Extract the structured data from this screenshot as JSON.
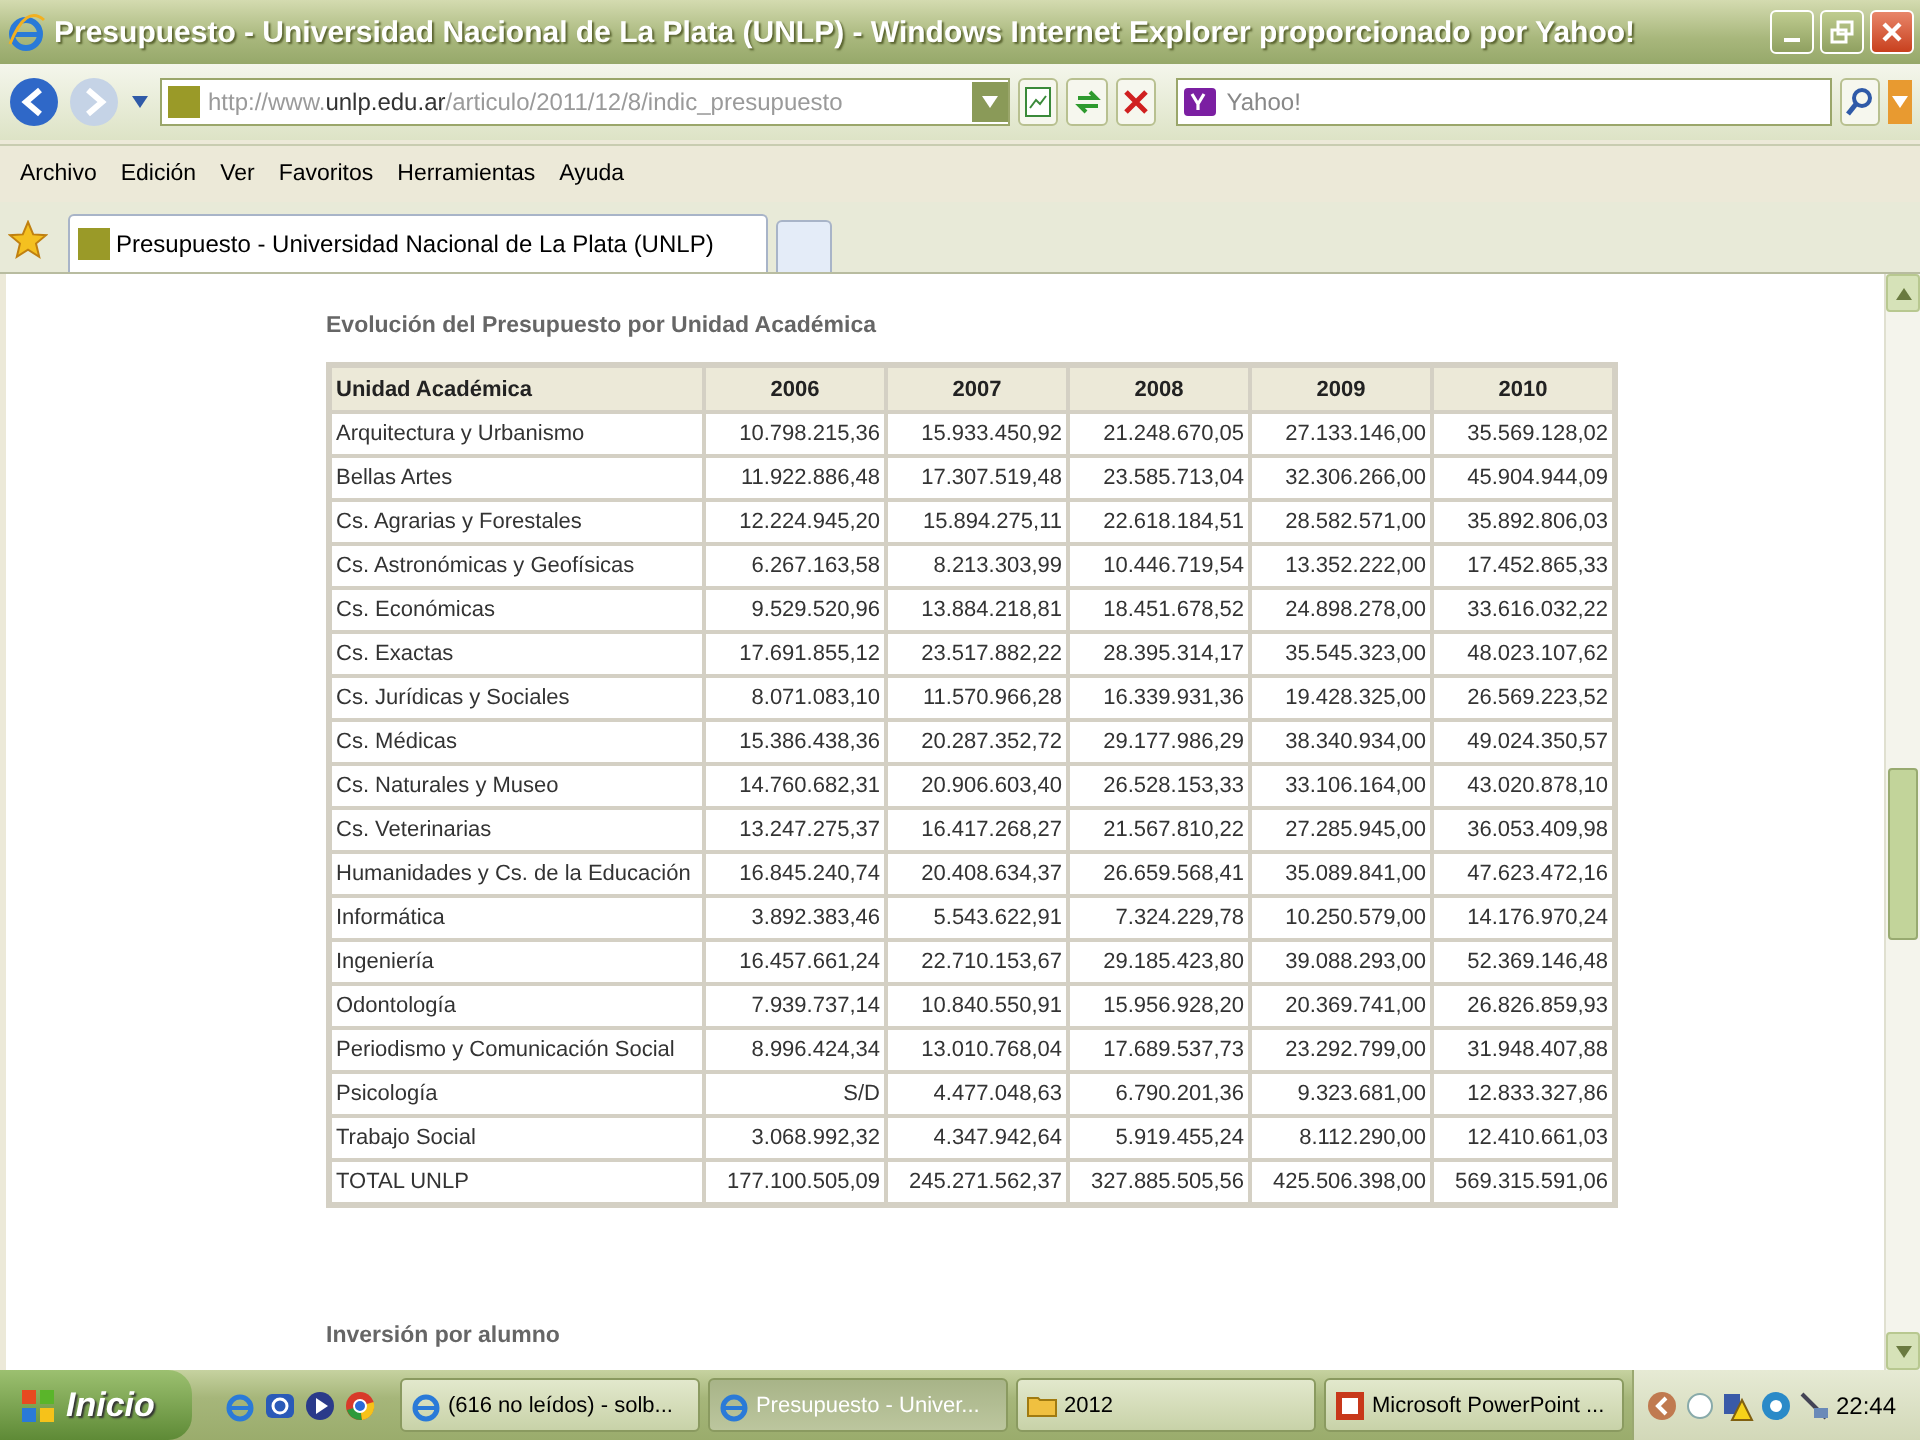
{
  "window": {
    "title": "Presupuesto - Universidad Nacional de La Plata (UNLP) - Windows Internet Explorer proporcionado por Yahoo!"
  },
  "address_bar": {
    "url_prefix": "http://www.",
    "url_domain": "unlp.edu.ar",
    "url_path": "/articulo/2011/12/8/indic_presupuesto"
  },
  "search": {
    "placeholder": "Yahoo!"
  },
  "menu": [
    "Archivo",
    "Edición",
    "Ver",
    "Favoritos",
    "Herramientas",
    "Ayuda"
  ],
  "tabs": [
    {
      "label": "Presupuesto - Universidad Nacional de La Plata (UNLP)",
      "selected": true
    }
  ],
  "page": {
    "heading": "Evolución del Presupuesto por Unidad Académica",
    "table": {
      "columns": [
        "Unidad Académica",
        "2006",
        "2007",
        "2008",
        "2009",
        "2010"
      ],
      "rows": [
        [
          "Arquitectura y Urbanismo",
          "10.798.215,36",
          "15.933.450,92",
          "21.248.670,05",
          "27.133.146,00",
          "35.569.128,02"
        ],
        [
          "Bellas Artes",
          "11.922.886,48",
          "17.307.519,48",
          "23.585.713,04",
          "32.306.266,00",
          "45.904.944,09"
        ],
        [
          "Cs. Agrarias y Forestales",
          "12.224.945,20",
          "15.894.275,11",
          "22.618.184,51",
          "28.582.571,00",
          "35.892.806,03"
        ],
        [
          "Cs. Astronómicas y Geofísicas",
          "6.267.163,58",
          "8.213.303,99",
          "10.446.719,54",
          "13.352.222,00",
          "17.452.865,33"
        ],
        [
          "Cs. Económicas",
          "9.529.520,96",
          "13.884.218,81",
          "18.451.678,52",
          "24.898.278,00",
          "33.616.032,22"
        ],
        [
          "Cs. Exactas",
          "17.691.855,12",
          "23.517.882,22",
          "28.395.314,17",
          "35.545.323,00",
          "48.023.107,62"
        ],
        [
          "Cs. Jurídicas y Sociales",
          "8.071.083,10",
          "11.570.966,28",
          "16.339.931,36",
          "19.428.325,00",
          "26.569.223,52"
        ],
        [
          "Cs. Médicas",
          "15.386.438,36",
          "20.287.352,72",
          "29.177.986,29",
          "38.340.934,00",
          "49.024.350,57"
        ],
        [
          "Cs. Naturales y Museo",
          "14.760.682,31",
          "20.906.603,40",
          "26.528.153,33",
          "33.106.164,00",
          "43.020.878,10"
        ],
        [
          "Cs. Veterinarias",
          "13.247.275,37",
          "16.417.268,27",
          "21.567.810,22",
          "27.285.945,00",
          "36.053.409,98"
        ],
        [
          "Humanidades y Cs. de la Educación",
          "16.845.240,74",
          "20.408.634,37",
          "26.659.568,41",
          "35.089.841,00",
          "47.623.472,16"
        ],
        [
          "Informática",
          "3.892.383,46",
          "5.543.622,91",
          "7.324.229,78",
          "10.250.579,00",
          "14.176.970,24"
        ],
        [
          "Ingeniería",
          "16.457.661,24",
          "22.710.153,67",
          "29.185.423,80",
          "39.088.293,00",
          "52.369.146,48"
        ],
        [
          "Odontología",
          "7.939.737,14",
          "10.840.550,91",
          "15.956.928,20",
          "20.369.741,00",
          "26.826.859,93"
        ],
        [
          "Periodismo y Comunicación Social",
          "8.996.424,34",
          "13.010.768,04",
          "17.689.537,73",
          "23.292.799,00",
          "31.948.407,88"
        ],
        [
          "Psicología",
          "S/D",
          "4.477.048,63",
          "6.790.201,36",
          "9.323.681,00",
          "12.833.327,86"
        ],
        [
          "Trabajo Social",
          "3.068.992,32",
          "4.347.942,64",
          "5.919.455,24",
          "8.112.290,00",
          "12.410.661,03"
        ],
        [
          "TOTAL UNLP",
          "177.100.505,09",
          "245.271.562,37",
          "327.885.505,56",
          "425.506.398,00",
          "569.315.591,06"
        ]
      ]
    },
    "section_heading": "Inversión por alumno"
  },
  "taskbar": {
    "start": "Inicio",
    "tasks": [
      {
        "label": "(616 no leídos) - solb...",
        "kind": "browser",
        "selected": false
      },
      {
        "label": "Presupuesto - Univer...",
        "kind": "browser",
        "selected": true
      },
      {
        "label": "2012",
        "kind": "folder",
        "selected": false
      },
      {
        "label": "Microsoft PowerPoint ...",
        "kind": "slides",
        "selected": false
      }
    ],
    "clock": "22:44"
  }
}
